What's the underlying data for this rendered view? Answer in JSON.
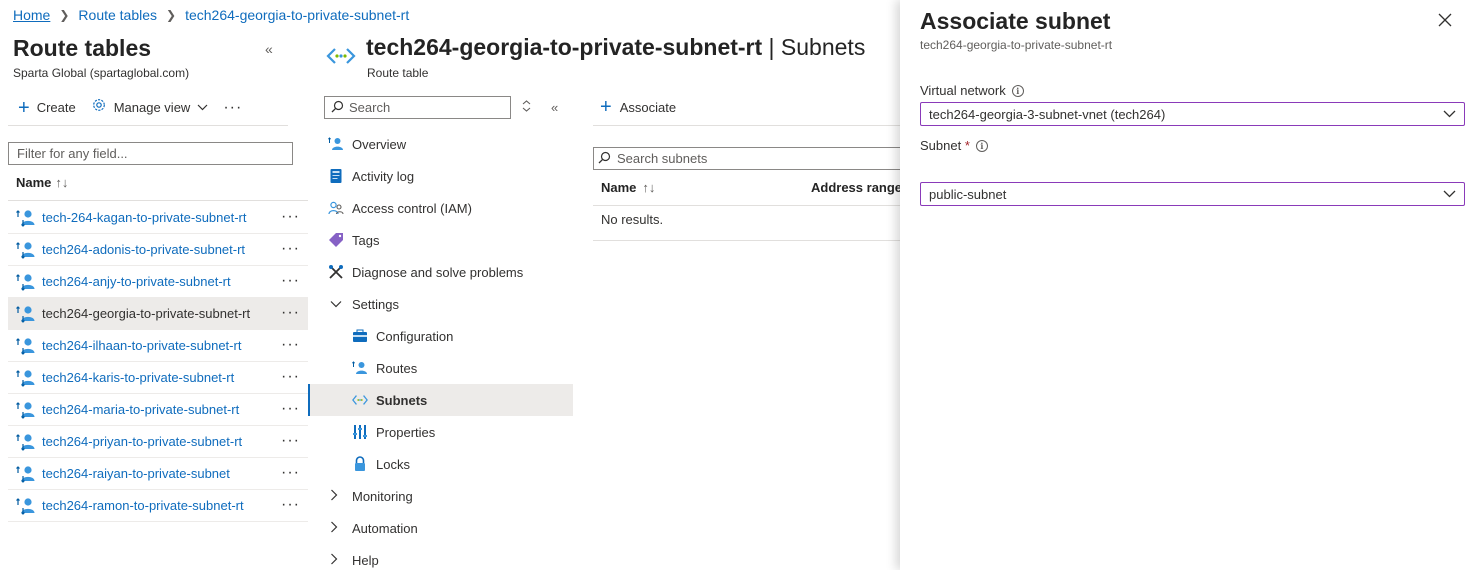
{
  "breadcrumb": [
    {
      "label": "Home"
    },
    {
      "label": "Route tables"
    },
    {
      "label": "tech264-georgia-to-private-subnet-rt"
    }
  ],
  "left_pane": {
    "title": "Route tables",
    "subtitle": "Sparta Global (spartaglobal.com)",
    "toolbar": {
      "create_label": "Create",
      "manage_view_label": "Manage view"
    },
    "filter_placeholder": "Filter for any field...",
    "column_name": "Name",
    "items": [
      {
        "label": "tech-264-kagan-to-private-subnet-rt",
        "selected": false
      },
      {
        "label": "tech264-adonis-to-private-subnet-rt",
        "selected": false
      },
      {
        "label": "tech264-anjy-to-private-subnet-rt",
        "selected": false
      },
      {
        "label": "tech264-georgia-to-private-subnet-rt",
        "selected": true
      },
      {
        "label": "tech264-ilhaan-to-private-subnet-rt",
        "selected": false
      },
      {
        "label": "tech264-karis-to-private-subnet-rt",
        "selected": false
      },
      {
        "label": "tech264-maria-to-private-subnet-rt",
        "selected": false
      },
      {
        "label": "tech264-priyan-to-private-subnet-rt",
        "selected": false
      },
      {
        "label": "tech264-raiyan-to-private-subnet",
        "selected": false
      },
      {
        "label": "tech264-ramon-to-private-subnet-rt",
        "selected": false
      }
    ]
  },
  "resource": {
    "title": "tech264-georgia-to-private-subnet-rt",
    "title_suffix": " | Subnets",
    "type_label": "Route table",
    "search_placeholder": "Search",
    "nav": [
      {
        "label": "Overview",
        "icon": "overview-icon",
        "kind": "item"
      },
      {
        "label": "Activity log",
        "icon": "activity-log-icon",
        "kind": "item"
      },
      {
        "label": "Access control (IAM)",
        "icon": "iam-icon",
        "kind": "item"
      },
      {
        "label": "Tags",
        "icon": "tag-icon",
        "kind": "item"
      },
      {
        "label": "Diagnose and solve problems",
        "icon": "wrench-icon",
        "kind": "item"
      },
      {
        "label": "Settings",
        "icon": "chevron-down-icon",
        "kind": "group-open"
      },
      {
        "label": "Configuration",
        "icon": "configuration-icon",
        "kind": "child"
      },
      {
        "label": "Routes",
        "icon": "routes-icon",
        "kind": "child"
      },
      {
        "label": "Subnets",
        "icon": "subnets-icon",
        "kind": "child-active"
      },
      {
        "label": "Properties",
        "icon": "properties-icon",
        "kind": "child"
      },
      {
        "label": "Locks",
        "icon": "lock-icon",
        "kind": "child"
      },
      {
        "label": "Monitoring",
        "icon": "chevron-right-icon",
        "kind": "group"
      },
      {
        "label": "Automation",
        "icon": "chevron-right-icon",
        "kind": "group"
      },
      {
        "label": "Help",
        "icon": "chevron-right-icon",
        "kind": "group"
      }
    ]
  },
  "subnets_view": {
    "associate_label": "Associate",
    "search_placeholder": "Search subnets",
    "col_name": "Name",
    "col_address": "Address range",
    "empty_text": "No results."
  },
  "blade": {
    "title": "Associate subnet",
    "subtitle": "tech264-georgia-to-private-subnet-rt",
    "vnet_label": "Virtual network",
    "vnet_value": "tech264-georgia-3-subnet-vnet (tech264)",
    "subnet_label": "Subnet",
    "subnet_required": "*",
    "subnet_value": "public-subnet"
  },
  "colors": {
    "link": "#0f6cbd",
    "focus_border": "#8a3ab9",
    "required": "#a4262c"
  }
}
